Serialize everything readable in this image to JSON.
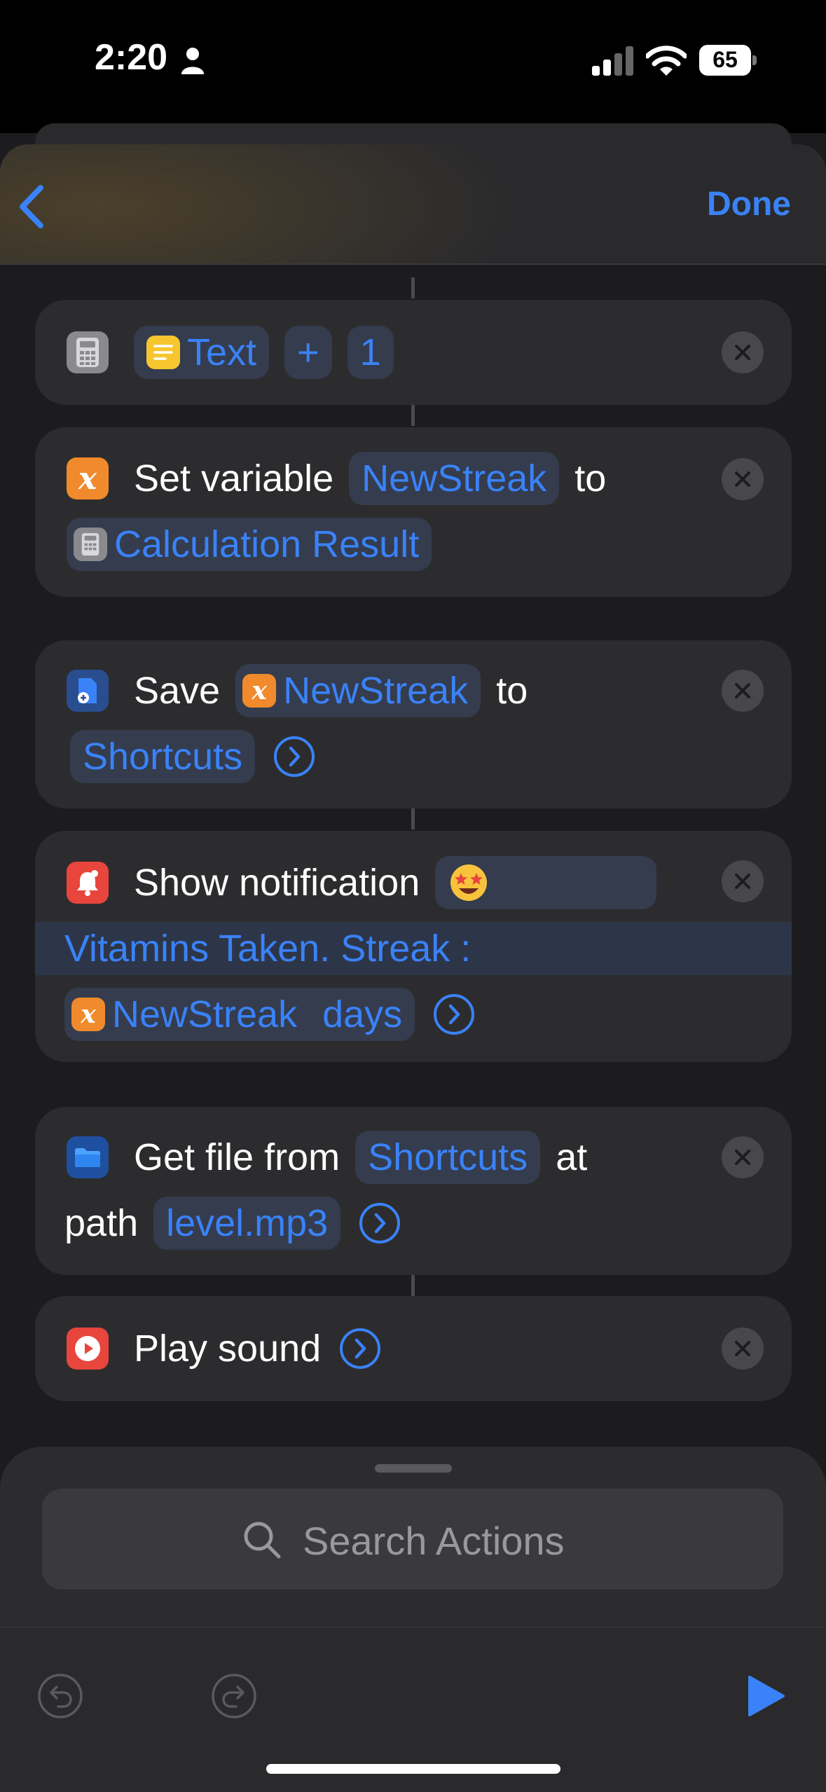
{
  "status": {
    "time": "2:20",
    "battery": "65"
  },
  "nav": {
    "done_label": "Done"
  },
  "actions": {
    "calculate": {
      "input": "Text",
      "operator": "+",
      "operand": "1"
    },
    "set_variable": {
      "label": "Set variable",
      "variable": "NewStreak",
      "to_word": "to",
      "value": "Calculation Result"
    },
    "save": {
      "label": "Save",
      "variable": "NewStreak",
      "to_word": "to",
      "destination": "Shortcuts"
    },
    "notification": {
      "label": "Show notification",
      "emoji": "🤩",
      "message": "Vitamins Taken. Streak :",
      "variable": "NewStreak",
      "suffix": "days"
    },
    "get_file": {
      "label": "Get file from",
      "source": "Shortcuts",
      "at_word": "at",
      "path_word": "path",
      "path_value": "level.mp3"
    },
    "play_sound": {
      "label": "Play sound"
    }
  },
  "search": {
    "placeholder": "Search Actions"
  },
  "colors": {
    "accent": "#3a82f7",
    "card": "#2c2c2e",
    "background": "#1c1c1e"
  }
}
